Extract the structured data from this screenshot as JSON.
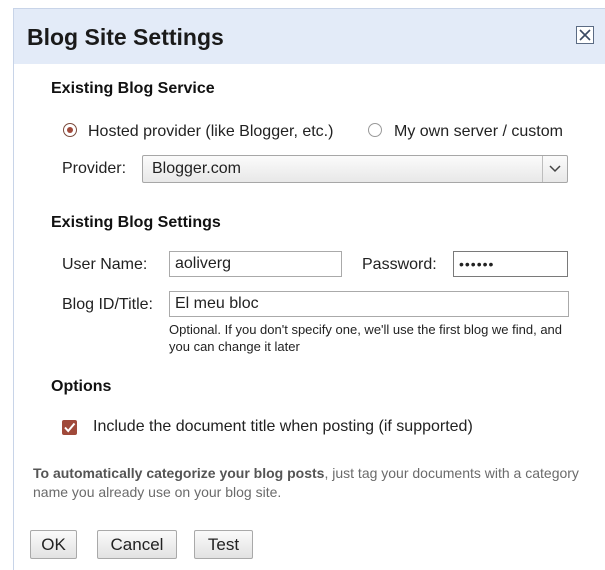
{
  "dialog": {
    "title": "Blog Site Settings",
    "close_icon": "close-x-icon"
  },
  "service": {
    "heading": "Existing Blog Service",
    "options": [
      {
        "label": "Hosted provider (like Blogger, etc.)",
        "selected": true
      },
      {
        "label": "My own server / custom",
        "selected": false
      }
    ],
    "provider_label": "Provider:",
    "provider_value": "Blogger.com",
    "provider_icon": "chevron-down-icon"
  },
  "settings": {
    "heading": "Existing Blog Settings",
    "username_label": "User Name:",
    "username_value": "aoliverg",
    "password_label": "Password:",
    "password_value": "••••••",
    "blogid_label": "Blog ID/Title:",
    "blogid_value": "El meu bloc",
    "hint": "Optional. If you don't specify one, we'll use the first blog we find, and you can change it later"
  },
  "options": {
    "heading": "Options",
    "include_title_label": "Include the document title when posting (if supported)",
    "include_title_checked": true
  },
  "footer": {
    "bold_text": "To automatically categorize your blog posts",
    "rest_text": ", just tag your documents with a category name you already use on your blog site."
  },
  "buttons": {
    "ok": "OK",
    "cancel": "Cancel",
    "test": "Test"
  },
  "colors": {
    "titlebar": "#e3ebf8",
    "accent": "#a0493a"
  }
}
